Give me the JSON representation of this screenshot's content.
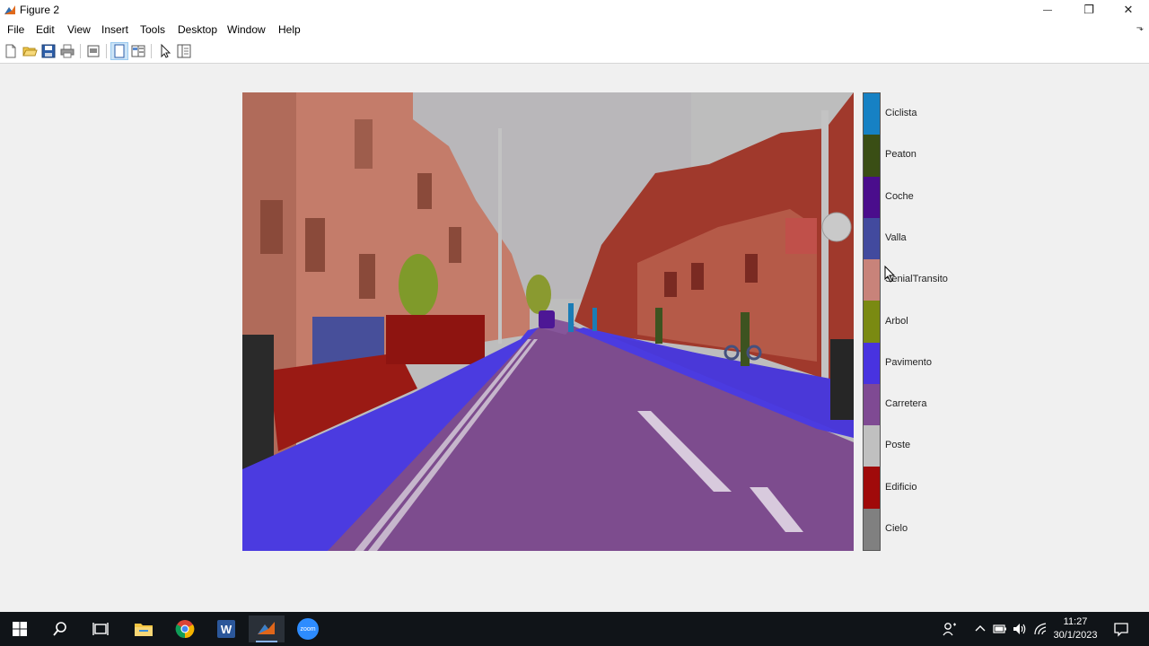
{
  "window": {
    "title": "Figure 2",
    "minimize_glyph": "—",
    "maximize_glyph": "❐",
    "close_glyph": "✕"
  },
  "menu": {
    "items": [
      "File",
      "Edit",
      "View",
      "Insert",
      "Tools",
      "Desktop",
      "Window",
      "Help"
    ],
    "overflow_glyph": "⬎"
  },
  "toolbar": {
    "icons": [
      "new-figure-icon",
      "open-icon",
      "save-icon",
      "print-icon",
      "print-preview-icon",
      "dock-figure-icon",
      "property-editor-icon",
      "pointer-icon",
      "plot-browser-icon"
    ],
    "active": "dock-figure-icon"
  },
  "colorbar": {
    "classes": [
      {
        "label": "Ciclista",
        "color": "#1681c4"
      },
      {
        "label": "Peaton",
        "color": "#3a4e15"
      },
      {
        "label": "Coche",
        "color": "#4a0d8c"
      },
      {
        "label": "Valla",
        "color": "#424a9e"
      },
      {
        "label": "SenialTransito",
        "color": "#c8837a"
      },
      {
        "label": "Arbol",
        "color": "#7a8a12"
      },
      {
        "label": "Pavimento",
        "color": "#4833e0"
      },
      {
        "label": "Carretera",
        "color": "#7f4a93"
      },
      {
        "label": "Poste",
        "color": "#c0c0c0"
      },
      {
        "label": "Edificio",
        "color": "#a00a0a"
      },
      {
        "label": "Cielo",
        "color": "#808080"
      }
    ]
  },
  "taskbar": {
    "apps": [
      "windows-start-icon",
      "search-icon",
      "task-view-icon",
      "file-explorer-icon",
      "chrome-icon",
      "word-icon",
      "matlab-icon",
      "zoom-icon"
    ],
    "active_app": "matlab-icon",
    "zoom_label": "zoom",
    "word_label": "W",
    "time": "11:27",
    "date": "30/1/2023"
  }
}
